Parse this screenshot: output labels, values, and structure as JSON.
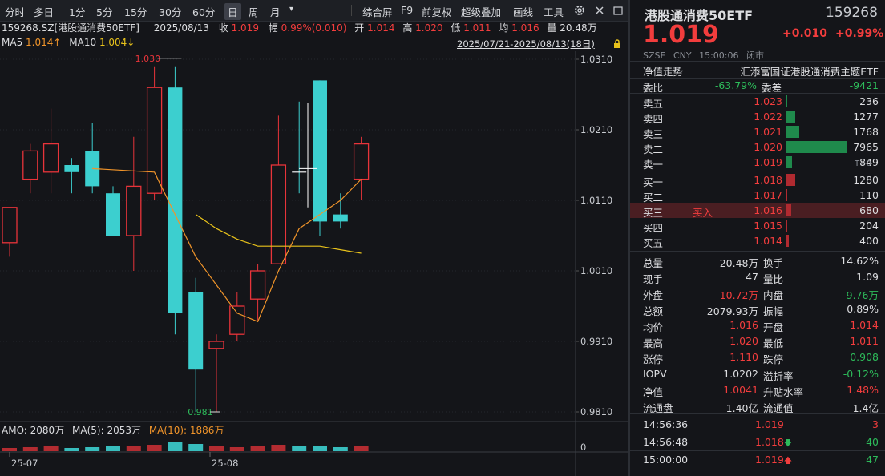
{
  "toolbar": {
    "periods": [
      "分时",
      "多日",
      "1分",
      "5分",
      "15分",
      "30分",
      "60分",
      "日",
      "周",
      "月"
    ],
    "selected": "日",
    "dropdown": "▾",
    "right_items": [
      "综合屏",
      "F9",
      "前复权",
      "超级叠加",
      "画线",
      "工具"
    ]
  },
  "info": {
    "code_name": "159268.SZ[港股通消费50ETF]",
    "date": "2025/08/13",
    "close_label": "收",
    "close": "1.019",
    "amp_label": "幅",
    "amp": "0.99%(0.010)",
    "open_label": "开",
    "open": "1.014",
    "high_label": "高",
    "high": "1.020",
    "low_label": "低",
    "low": "1.011",
    "avg_label": "均",
    "avg": "1.016",
    "vol_label": "量",
    "vol": "20.48万",
    "ma5_label": "MA5",
    "ma5": "1.014↑",
    "ma10_label": "MA10",
    "ma10": "1.004↓",
    "range": "2025/07/21-2025/08/13(18日)"
  },
  "chart_data": {
    "type": "candlestick",
    "y_ticks": [
      "1.0310",
      "1.0210",
      "1.0110",
      "1.0010",
      "0.9910",
      "0.9810"
    ],
    "x_ticks": [
      "25-07",
      "25-08"
    ],
    "max_label": "1.030",
    "min_label": "0.981",
    "candles": [
      {
        "o": 1.005,
        "c": 1.01,
        "h": 1.01,
        "l": 1.003
      },
      {
        "o": 1.014,
        "c": 1.018,
        "h": 1.019,
        "l": 1.012
      },
      {
        "o": 1.015,
        "c": 1.019,
        "h": 1.024,
        "l": 1.012
      },
      {
        "o": 1.016,
        "c": 1.015,
        "h": 1.017,
        "l": 1.012
      },
      {
        "o": 1.018,
        "c": 1.013,
        "h": 1.022,
        "l": 1.012
      },
      {
        "o": 1.012,
        "c": 1.006,
        "h": 1.013,
        "l": 1.006
      },
      {
        "o": 1.006,
        "c": 1.013,
        "h": 1.02,
        "l": 1.001
      },
      {
        "o": 1.012,
        "c": 1.027,
        "h": 1.03,
        "l": 1.011
      },
      {
        "o": 1.027,
        "c": 0.995,
        "h": 1.03,
        "l": 0.992
      },
      {
        "o": 0.998,
        "c": 0.987,
        "h": 1.0,
        "l": 0.981
      },
      {
        "o": 0.99,
        "c": 0.991,
        "h": 0.992,
        "l": 0.981
      },
      {
        "o": 0.992,
        "c": 0.996,
        "h": 0.998,
        "l": 0.991
      },
      {
        "o": 0.997,
        "c": 1.001,
        "h": 1.002,
        "l": 0.994
      },
      {
        "o": 1.002,
        "c": 1.016,
        "h": 1.023,
        "l": 1.002
      },
      {
        "o": 1.015,
        "c": 1.015,
        "h": 1.025,
        "l": 1.012
      },
      {
        "o": 1.028,
        "c": 1.008,
        "h": 1.028,
        "l": 1.006
      },
      {
        "o": 1.009,
        "c": 1.008,
        "h": 1.012,
        "l": 1.007
      },
      {
        "o": 1.014,
        "c": 1.019,
        "h": 1.02,
        "l": 1.011
      }
    ],
    "ma5": [
      {
        "i": 4,
        "v": 1.0155
      },
      {
        "i": 7,
        "v": 1.015
      },
      {
        "i": 8,
        "v": 1.009
      },
      {
        "i": 9,
        "v": 1.003
      },
      {
        "i": 10,
        "v": 0.999
      },
      {
        "i": 11,
        "v": 0.995
      },
      {
        "i": 12,
        "v": 0.9938
      },
      {
        "i": 13,
        "v": 1.001
      },
      {
        "i": 14,
        "v": 1.007
      },
      {
        "i": 15,
        "v": 1.009
      },
      {
        "i": 16,
        "v": 1.011
      },
      {
        "i": 17,
        "v": 1.014
      }
    ],
    "ma10": [
      {
        "i": 9,
        "v": 1.009
      },
      {
        "i": 10,
        "v": 1.007
      },
      {
        "i": 11,
        "v": 1.0055
      },
      {
        "i": 12,
        "v": 1.0045
      },
      {
        "i": 13,
        "v": 1.0045
      },
      {
        "i": 14,
        "v": 1.0045
      },
      {
        "i": 15,
        "v": 1.0045
      },
      {
        "i": 16,
        "v": 1.004
      },
      {
        "i": 17,
        "v": 1.0035
      }
    ],
    "volume": {
      "label_amo": "AMO: 2080万",
      "label_ma5": "MA(5): 2053万",
      "label_ma10": "MA(10): 1886万",
      "zero_tick": "0",
      "values": [
        0.2,
        0.25,
        0.3,
        0.2,
        0.25,
        0.3,
        0.35,
        0.4,
        0.55,
        0.45,
        0.3,
        0.25,
        0.3,
        0.4,
        0.35,
        0.3,
        0.25,
        0.3
      ]
    }
  },
  "quote": {
    "name": "港股通消费50ETF",
    "code": "159268",
    "price": "1.019",
    "change": "+0.010",
    "pct": "+0.99%",
    "market": "SZSE",
    "currency": "CNY",
    "time": "15:00:06",
    "status": "闭市",
    "nav_trend": "净值走势",
    "fund_name": "汇添富国证港股通消费主题ETF",
    "wb_label": "委比",
    "wb": "-63.79%",
    "wc_label": "委差",
    "wc": "-9421",
    "t0": "T+0"
  },
  "book": {
    "asks": [
      {
        "label": "卖五",
        "price": "1.023",
        "vol": "236",
        "frac": 0.03
      },
      {
        "label": "卖四",
        "price": "1.022",
        "vol": "1277",
        "frac": 0.16
      },
      {
        "label": "卖三",
        "price": "1.021",
        "vol": "1768",
        "frac": 0.22
      },
      {
        "label": "卖二",
        "price": "1.020",
        "vol": "7965",
        "frac": 1.0
      },
      {
        "label": "卖一",
        "price": "1.019",
        "vol": "849",
        "frac": 0.11
      }
    ],
    "bids": [
      {
        "label": "买一",
        "price": "1.018",
        "vol": "1280",
        "frac": 0.16
      },
      {
        "label": "买二",
        "price": "1.017",
        "vol": "110",
        "frac": 0.015
      },
      {
        "label": "买三",
        "price": "1.016",
        "vol": "680",
        "frac": 0.09,
        "tag": "买入"
      },
      {
        "label": "买四",
        "price": "1.015",
        "vol": "204",
        "frac": 0.03
      },
      {
        "label": "买五",
        "price": "1.014",
        "vol": "400",
        "frac": 0.05
      }
    ]
  },
  "stats": [
    {
      "l1": "总量",
      "v1": "20.48万",
      "c1": "wht",
      "l2": "换手",
      "v2": "14.62%",
      "c2": "wht"
    },
    {
      "l1": "现手",
      "v1": "47",
      "c1": "wht",
      "l2": "量比",
      "v2": "1.09",
      "c2": "wht"
    },
    {
      "l1": "外盘",
      "v1": "10.72万",
      "c1": "red",
      "l2": "内盘",
      "v2": "9.76万",
      "c2": "grn"
    },
    {
      "l1": "总额",
      "v1": "2079.93万",
      "c1": "wht",
      "l2": "振幅",
      "v2": "0.89%",
      "c2": "wht"
    },
    {
      "l1": "均价",
      "v1": "1.016",
      "c1": "red",
      "l2": "开盘",
      "v2": "1.014",
      "c2": "red"
    },
    {
      "l1": "最高",
      "v1": "1.020",
      "c1": "red",
      "l2": "最低",
      "v2": "1.011",
      "c2": "red"
    },
    {
      "l1": "涨停",
      "v1": "1.110",
      "c1": "red",
      "l2": "跌停",
      "v2": "0.908",
      "c2": "grn"
    }
  ],
  "stats2": [
    {
      "l1": "IOPV",
      "v1": "1.0202",
      "c1": "wht",
      "l2": "溢折率",
      "v2": "-0.12%",
      "c2": "grn"
    },
    {
      "l1": "净值",
      "v1": "1.0041",
      "c1": "red",
      "l2": "升贴水率",
      "v2": "1.48%",
      "c2": "red"
    },
    {
      "l1": "流通盘",
      "v1": "1.40亿",
      "c1": "wht",
      "l2": "流通值",
      "v2": "1.4亿",
      "c2": "wht"
    }
  ],
  "ticks": [
    {
      "t": "14:56:36",
      "p": "1.019",
      "arrow": "",
      "v": "3",
      "vc": "red"
    },
    {
      "t": "14:56:48",
      "p": "1.018",
      "arrow": "down",
      "v": "40",
      "vc": "grn"
    },
    {
      "t": "15:00:00",
      "p": "1.019",
      "arrow": "up",
      "v": "47",
      "vc": "grn"
    }
  ],
  "colors": {
    "up": "#e8343a",
    "down": "#3ccfcf",
    "ma5": "#f0942a",
    "ma10": "#e8c21b"
  }
}
